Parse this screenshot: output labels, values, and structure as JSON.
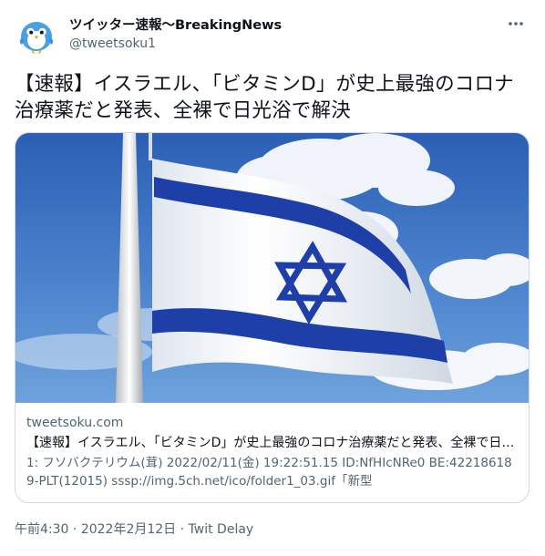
{
  "author": {
    "display_name": "ツイッター速報〜BreakingNews",
    "handle": "@tweetsoku1",
    "avatar_icon": "blue-bird-avatar-icon"
  },
  "tweet": {
    "text": "【速報】イスラエル、「ビタミンD」が史上最強のコロナ治療薬だと発表、全裸で日光浴で解決"
  },
  "card": {
    "image_icon": "israel-flag-image",
    "domain": "tweetsoku.com",
    "title": "【速報】イスラエル、「ビタミンD」が史上最強のコロナ治療薬だと発表、全裸で日光浴で解決",
    "description": "1: フソバクテリウム(茸) 2022/02/11(金) 19:22:51.15 ID:NfHIcNRe0 BE:422186189-PLT(12015) sssp://img.5ch.net/ico/folder1_03.gif「新型"
  },
  "meta": {
    "time": "午前4:30",
    "separator": " · ",
    "date": "2022年2月12日",
    "source": "Twit Delay"
  },
  "colors": {
    "text": "#0f1419",
    "secondary": "#536471",
    "border": "#cfd9de",
    "flag_blue": "#1f3fa8"
  }
}
